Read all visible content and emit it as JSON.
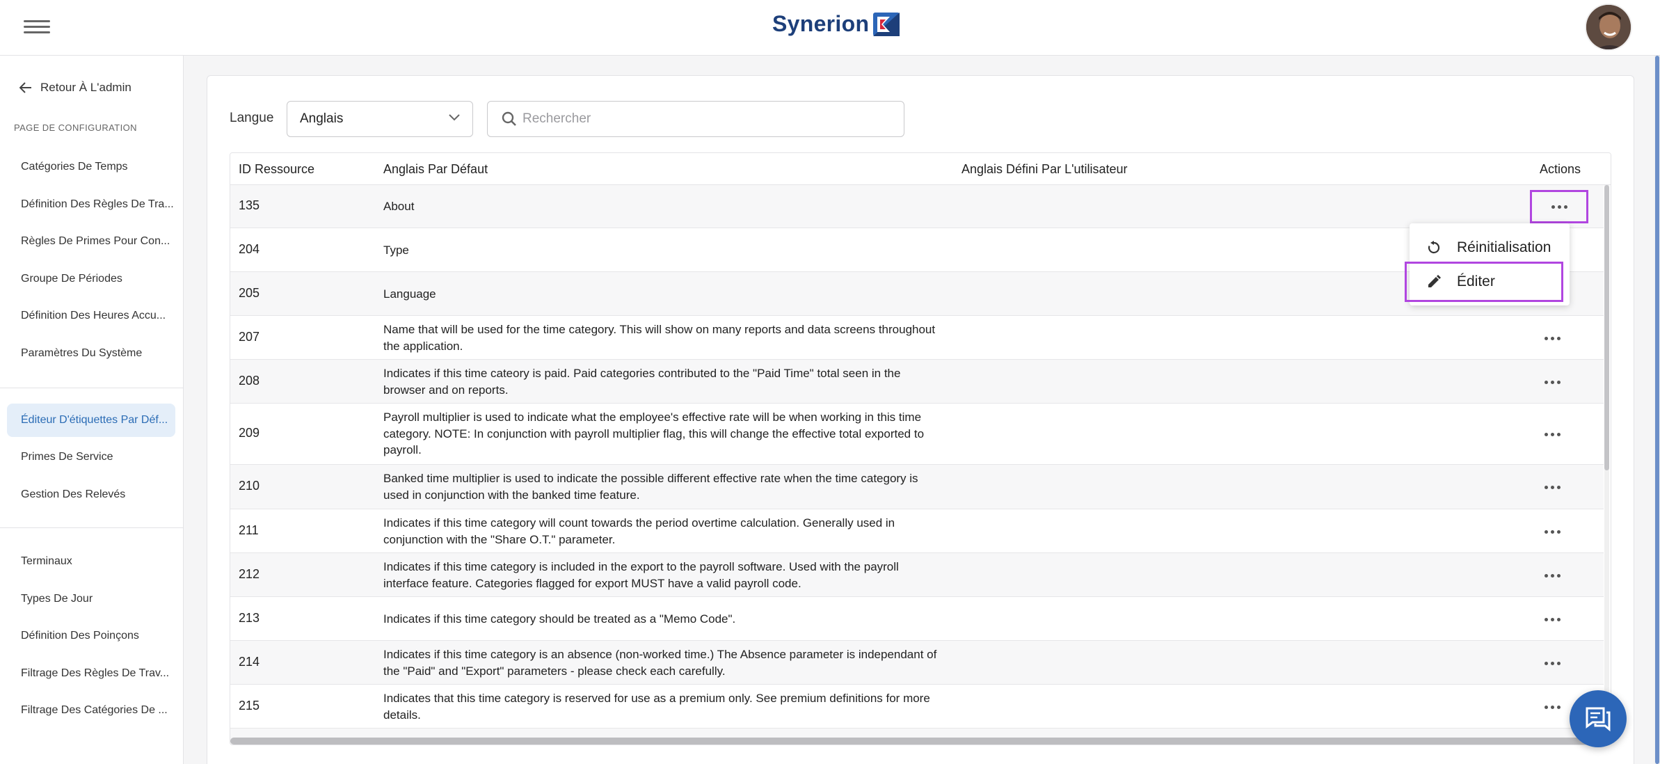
{
  "app": {
    "brand": "Synerion"
  },
  "sidebar": {
    "back_label": "Retour À L'admin",
    "caption": "PAGE DE CONFIGURATION",
    "group1": [
      "Catégories De Temps",
      "Définition Des Règles De Tra...",
      "Règles De Primes Pour Con...",
      "Groupe De Périodes",
      "Définition Des Heures Accu...",
      "Paramètres Du Système"
    ],
    "group2": [
      "Éditeur D'étiquettes Par Déf...",
      "Primes De Service",
      "Gestion Des Relevés"
    ],
    "group3": [
      "Terminaux",
      "Types De Jour",
      "Définition Des Poinçons",
      "Filtrage Des Règles De Trav...",
      "Filtrage Des Catégories De ..."
    ],
    "active_item": "Éditeur D'étiquettes Par Déf..."
  },
  "filters": {
    "language_label": "Langue",
    "language_value": "Anglais",
    "search_placeholder": "Rechercher"
  },
  "table": {
    "columns": {
      "id": "ID Ressource",
      "default": "Anglais Par Défaut",
      "user": "Anglais Défini Par L'utilisateur",
      "actions": "Actions"
    },
    "rows": [
      {
        "id": "135",
        "default": "About"
      },
      {
        "id": "204",
        "default": "Type"
      },
      {
        "id": "205",
        "default": "Language"
      },
      {
        "id": "207",
        "default": "Name that will be used for the time category. This will show on many reports and data screens throughout the application."
      },
      {
        "id": "208",
        "default": "Indicates if this time cateory is paid. Paid categories contributed to the \"Paid Time\" total seen in the browser and on reports."
      },
      {
        "id": "209",
        "default": "Payroll multiplier is used to indicate what the employee's effective rate will be when working in this time category. NOTE: In conjunction with payroll multiplier flag, this will change the effective total exported to payroll."
      },
      {
        "id": "210",
        "default": "Banked time multiplier is used to indicate the possible different effective rate when the time category is used in conjunction with the banked time feature."
      },
      {
        "id": "211",
        "default": "Indicates if this time category will count towards the period overtime calculation. Generally used in conjunction with the \"Share O.T.\" parameter."
      },
      {
        "id": "212",
        "default": "Indicates if this time category is included in the export to the payroll software. Used with the payroll interface feature. Categories flagged for export MUST have a valid payroll code."
      },
      {
        "id": "213",
        "default": "Indicates if this time category should be treated as a \"Memo Code\"."
      },
      {
        "id": "214",
        "default": "Indicates if this time category is an absence (non-worked time.) The Absence parameter is independant of the \"Paid\" and \"Export\" parameters - please check each carefully."
      },
      {
        "id": "215",
        "default": "Indicates that this time category is reserved for use as a premium only. See premium definitions for more details."
      }
    ]
  },
  "action_menu": {
    "reset_label": "Réinitialisation",
    "edit_label": "Éditer"
  },
  "colors": {
    "brand": "#1d3f7a",
    "accent": "#2c66b8",
    "highlight": "#b146e0"
  }
}
